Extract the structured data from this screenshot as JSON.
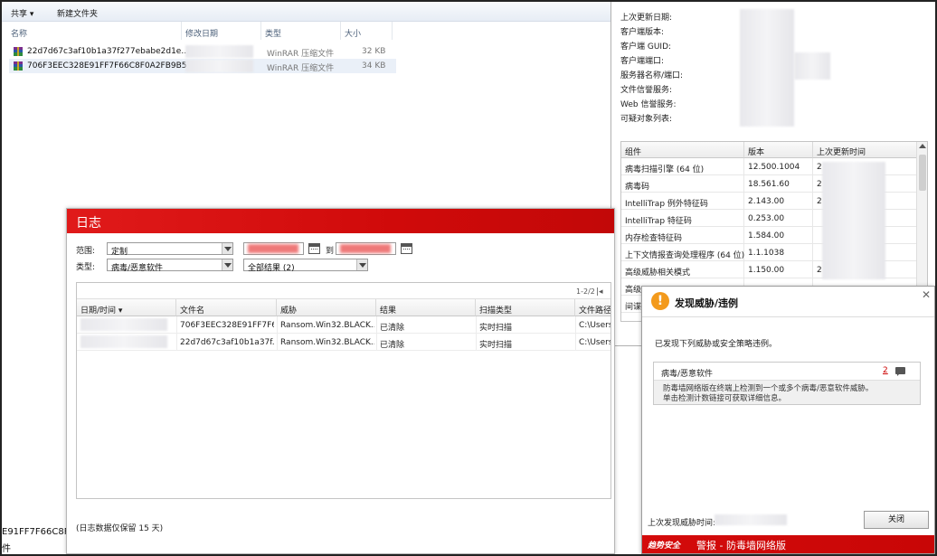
{
  "explorer": {
    "toolbar": {
      "share": "共享 ▾",
      "new_folder": "新建文件夹"
    },
    "columns": {
      "name": "名称",
      "modified": "修改日期",
      "type": "类型",
      "size": "大小"
    },
    "files": [
      {
        "name": "22d7d67c3af10b1a37f277ebabe2d1e...",
        "type": "WinRAR 压缩文件",
        "size": "32 KB",
        "icon": "winrar-archive-icon"
      },
      {
        "name": "706F3EEC328E91FF7F66C8F0A2FB9B5...",
        "type": "WinRAR 压缩文件",
        "size": "34 KB",
        "icon": "winrar-archive-icon"
      }
    ],
    "status": {
      "line1": "E91FF7F66C8F0",
      "line2": "件"
    }
  },
  "info_panel": {
    "labels": [
      "上次更新日期:",
      "客户端版本:",
      "客户端 GUID:",
      "客户端端口:",
      "服务器名称/端口:",
      "文件信誉服务:",
      "Web 信誉服务:",
      "可疑对象列表:"
    ],
    "table": {
      "headers": [
        "组件",
        "版本",
        "上次更新时间"
      ],
      "rows": [
        {
          "component": "病毒扫描引擎 (64 位)",
          "version": "12.500.1004",
          "updated": "2"
        },
        {
          "component": "病毒码",
          "version": "18.561.60",
          "updated": "2"
        },
        {
          "component": "IntelliTrap 例外特征码",
          "version": "2.143.00",
          "updated": "2"
        },
        {
          "component": "IntelliTrap 特征码",
          "version": "0.253.00",
          "updated": ""
        },
        {
          "component": "内存检查特征码",
          "version": "1.584.00",
          "updated": ""
        },
        {
          "component": "上下文情报查询处理程序 (64 位)",
          "version": "1.1.1038",
          "updated": ""
        },
        {
          "component": "高级威胁相关模式",
          "version": "1.150.00",
          "updated": "2"
        },
        {
          "component": "高级",
          "version": "",
          "updated": ""
        },
        {
          "component": "间谍",
          "version": "",
          "updated": ""
        }
      ]
    }
  },
  "log_window": {
    "title": "日志",
    "range_label": "范围:",
    "range_value": "定制",
    "to_label": "到",
    "type_label": "类型:",
    "type_value": "病毒/恶意软件",
    "result_value": "全部结果 (2)",
    "pager": "1-2/2",
    "columns": [
      "日期/时间 ▾",
      "文件名",
      "威胁",
      "结果",
      "扫描类型",
      "文件路径"
    ],
    "rows": [
      {
        "file": "706F3EEC328E91FF7F6...",
        "threat": "Ransom.Win32.BLACK...",
        "result": "已清除",
        "scan": "实时扫描",
        "path": "C:\\Users\\"
      },
      {
        "file": "22d7d67c3af10b1a37f...",
        "threat": "Ransom.Win32.BLACK...",
        "result": "已清除",
        "scan": "实时扫描",
        "path": "C:\\Users\\"
      }
    ],
    "footer": "(日志数据仅保留 15 天)"
  },
  "popup": {
    "title": "发现威胁/违例",
    "description": "已发现下列威胁或安全策略违例。",
    "category": "病毒/恶意软件",
    "count": "2",
    "detail_line1": "防毒墙网络版在终端上检测到一个或多个病毒/恶意软件威胁。",
    "detail_line2": "单击检测计数链接可获取详细信息。",
    "last_found_label": "上次发现威胁时间:",
    "close_button": "关闭",
    "brand": "趋势安全",
    "banner": "警报 - 防毒墙网络版"
  },
  "colors": {
    "alert_red": "#d40b0b",
    "warning_orange": "#f39a1c",
    "link_red": "#cc0000"
  }
}
